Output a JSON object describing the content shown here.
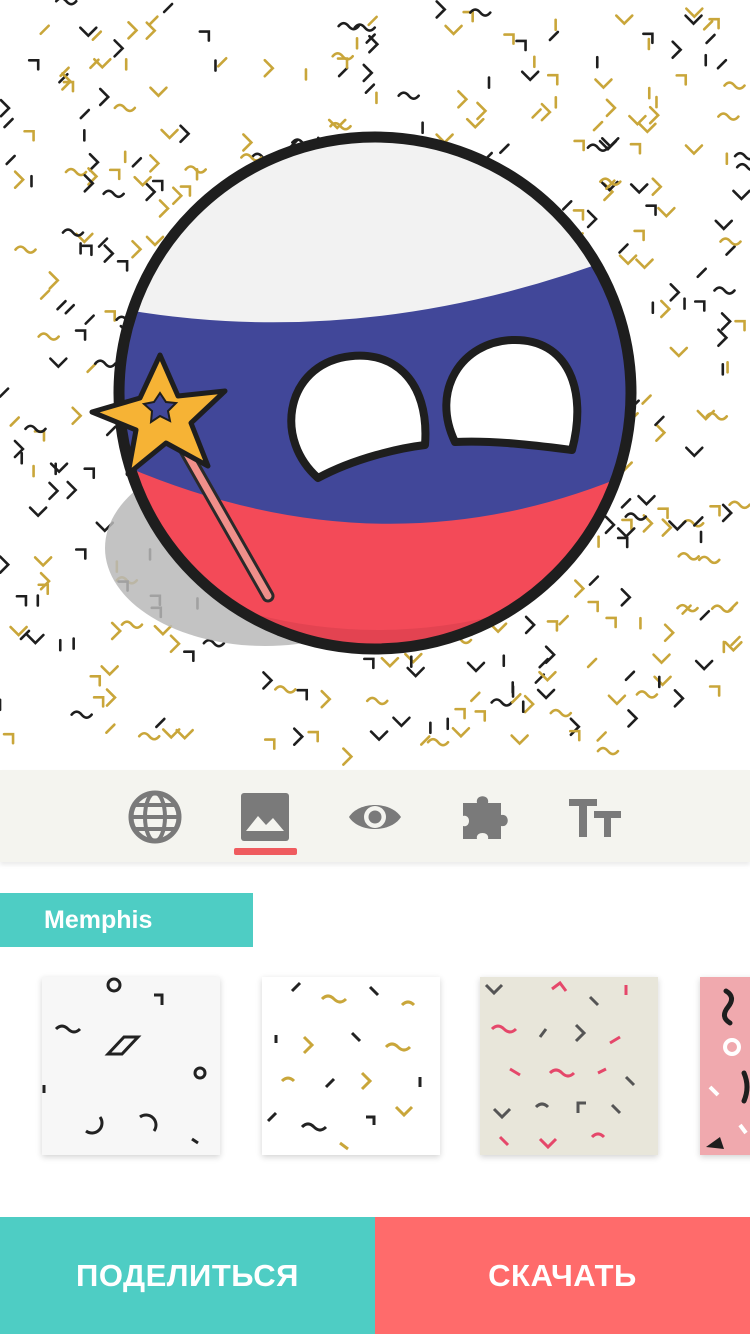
{
  "colors": {
    "teal": "#4ecdc4",
    "coral": "#ff6b6b",
    "toolbar_bg": "#f4f4ef",
    "icon_gray": "#7a7a7a",
    "active_underline": "#ef5b5f",
    "flag_white": "#f2f2f2",
    "flag_blue": "#414799",
    "flag_red": "#f34a58",
    "star_yellow": "#f6b335"
  },
  "canvas": {
    "character": "russia-countryball",
    "accessory": "magic-wand-star-icon",
    "background": "memphis-confetti"
  },
  "toolbar": {
    "tools": [
      {
        "icon": "globe-icon",
        "active": false
      },
      {
        "icon": "image-icon",
        "active": true
      },
      {
        "icon": "eye-icon",
        "active": false
      },
      {
        "icon": "puzzle-icon",
        "active": false
      },
      {
        "icon": "text-size-icon",
        "active": false
      }
    ]
  },
  "category": {
    "label": "Memphis"
  },
  "backgrounds": [
    {
      "pattern": "white-shapes",
      "selected": false
    },
    {
      "pattern": "gold-black-confetti",
      "selected": true
    },
    {
      "pattern": "beige-pink-confetti",
      "selected": false
    },
    {
      "pattern": "pink-squiggles",
      "selected": false
    }
  ],
  "actions": {
    "share_label": "ПОДЕЛИТЬСЯ",
    "download_label": "СКАЧАТЬ"
  }
}
